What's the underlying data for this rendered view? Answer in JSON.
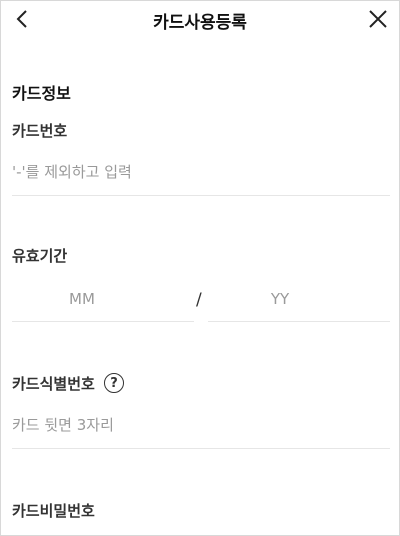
{
  "header": {
    "title": "카드사용등록",
    "back_icon": "chevron-left-icon",
    "close_icon": "close-icon"
  },
  "card_info": {
    "section_title": "카드정보",
    "card_number": {
      "label": "카드번호",
      "placeholder": "'-'를 제외하고 입력"
    },
    "expiry": {
      "label": "유효기간",
      "month_placeholder": "MM",
      "separator": "/",
      "year_placeholder": "YY"
    },
    "cvc": {
      "label": "카드식별번호",
      "help_symbol": "?",
      "placeholder": "카드 뒷면 3자리"
    },
    "password": {
      "label": "카드비밀번호"
    }
  }
}
